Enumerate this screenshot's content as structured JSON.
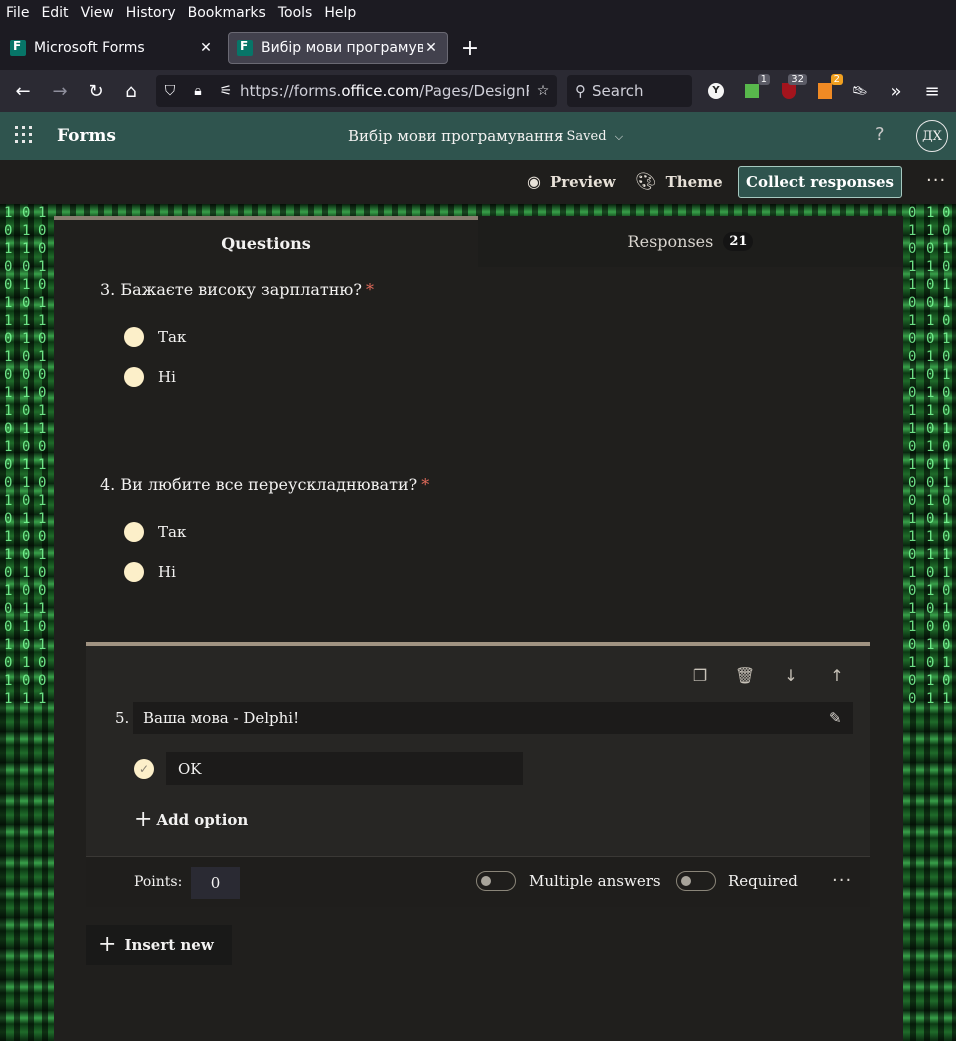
{
  "menubar": {
    "items": [
      "File",
      "Edit",
      "View",
      "History",
      "Bookmarks",
      "Tools",
      "Help"
    ]
  },
  "tabs": [
    {
      "title": "Microsoft Forms",
      "active": false
    },
    {
      "title": "Вибір мови програмування",
      "active": true
    }
  ],
  "navbar": {
    "url_prefix": "https://forms.",
    "url_domain": "office.com",
    "url_rest": "/Pages/DesignPa",
    "search_placeholder": "Search",
    "ext_badges": [
      "1",
      "32",
      "2"
    ]
  },
  "forms_header": {
    "brand": "Forms",
    "form_title": "Вибір мови програмування",
    "status": "-  Saved",
    "help": "?",
    "avatar": "ДХ"
  },
  "actions": {
    "preview": "Preview",
    "theme": "Theme",
    "collect": "Collect responses"
  },
  "panel_tabs": {
    "questions": "Questions",
    "responses": "Responses",
    "responses_count": "21"
  },
  "questions": [
    {
      "title": "3. Бажаєте високу зарплатню?",
      "required": "*",
      "options": [
        "Так",
        "Ні"
      ]
    },
    {
      "title": "4. Ви любите все переускладнювати?",
      "required": "*",
      "options": [
        "Так",
        "Ні"
      ]
    }
  ],
  "active_question": {
    "number": "5.",
    "text": "Ваша мова - Delphi!",
    "option": "OK",
    "add_option": "Add option",
    "points_label": "Points:",
    "points_value": "0",
    "multiple_answers": "Multiple answers",
    "required": "Required"
  },
  "insert_new": "Insert new",
  "colors": {
    "forms_header": "#2f544e",
    "panel": "#201f1d",
    "radio": "#fcefc9",
    "required_star": "#e06a5a"
  }
}
